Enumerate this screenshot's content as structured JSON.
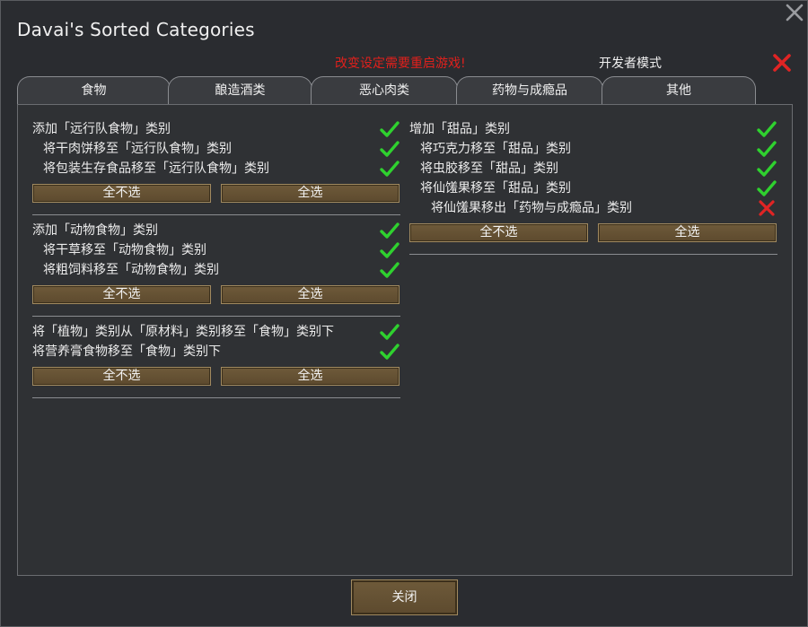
{
  "window": {
    "title": "Davai's Sorted Categories"
  },
  "header": {
    "restart_note": "改变设定需要重启游戏!",
    "dev_mode_label": "开发者模式"
  },
  "tabs": [
    {
      "label": "食物"
    },
    {
      "label": "酿造酒类"
    },
    {
      "label": "恶心肉类"
    },
    {
      "label": "药物与成瘾品"
    },
    {
      "label": "其他"
    }
  ],
  "left_groups": [
    {
      "rows": [
        {
          "label": "添加「远行队食物」类别",
          "checked": true
        },
        {
          "label": "将干肉饼移至「远行队食物」类别",
          "checked": true
        },
        {
          "label": "将包装生存食品移至「远行队食物」类别",
          "checked": true
        }
      ],
      "deselect_label": "全不选",
      "select_label": "全选"
    },
    {
      "rows": [
        {
          "label": "添加「动物食物」类别",
          "checked": true
        },
        {
          "label": "将干草移至「动物食物」类别",
          "checked": true
        },
        {
          "label": "将粗饲料移至「动物食物」类别",
          "checked": true
        }
      ],
      "deselect_label": "全不选",
      "select_label": "全选"
    },
    {
      "rows": [
        {
          "label": "将「植物」类别从「原材料」类别移至「食物」类别下",
          "checked": true
        },
        {
          "label": "将营养膏食物移至「食物」类别下",
          "checked": true
        }
      ],
      "deselect_label": "全不选",
      "select_label": "全选"
    }
  ],
  "right_groups": [
    {
      "rows": [
        {
          "label": "增加「甜品」类别",
          "checked": true
        },
        {
          "label": "将巧克力移至「甜品」类别",
          "checked": true
        },
        {
          "label": "将虫胶移至「甜品」类别",
          "checked": true
        },
        {
          "label": "将仙馐果移至「甜品」类别",
          "checked": true
        },
        {
          "label": "将仙馐果移出「药物与成瘾品」类别",
          "checked": false
        }
      ],
      "deselect_label": "全不选",
      "select_label": "全选"
    }
  ],
  "footer": {
    "close_label": "关闭"
  },
  "colors": {
    "check": "#2fd12f",
    "cross": "#e02424",
    "button": "#6e5a3a",
    "warning": "#e0201c"
  }
}
